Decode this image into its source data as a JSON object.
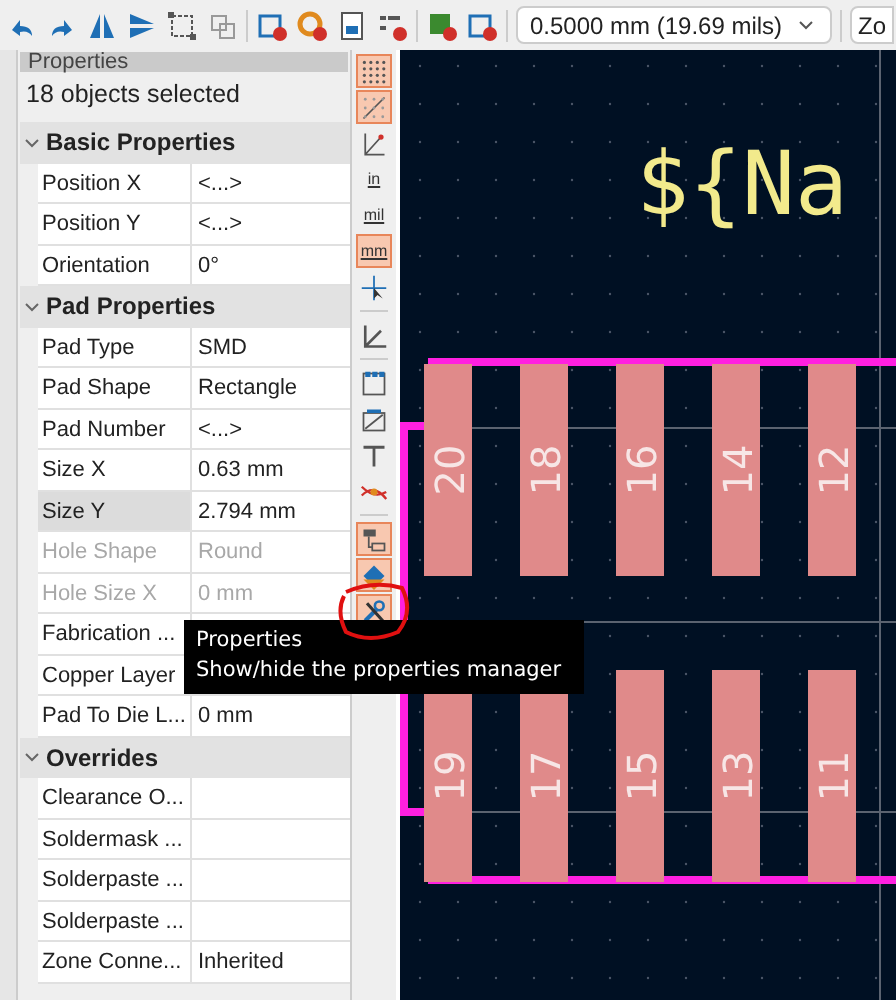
{
  "toolbar": {
    "icons": [
      {
        "kind": "undo"
      },
      {
        "kind": "redo"
      },
      {
        "kind": "flip-v"
      },
      {
        "kind": "flip-h"
      },
      {
        "kind": "group"
      },
      {
        "kind": "ungroup"
      },
      {
        "kind": "sep"
      },
      {
        "kind": "board-gear"
      },
      {
        "kind": "zone-gear"
      },
      {
        "kind": "report"
      },
      {
        "kind": "checklist"
      },
      {
        "kind": "sep"
      },
      {
        "kind": "board-down"
      },
      {
        "kind": "board-up"
      },
      {
        "kind": "sep"
      }
    ],
    "grid_dropdown": "0.5000 mm (19.69 mils)",
    "zoom_dropdown": "Zo"
  },
  "properties": {
    "title": "Properties",
    "summary": "18 objects selected",
    "rows": [
      {
        "kind": "section",
        "label": "Basic Properties"
      },
      {
        "kind": "prop",
        "label": "Position X",
        "value": "<...>",
        "disabled": false,
        "selected": false
      },
      {
        "kind": "prop",
        "label": "Position Y",
        "value": "<...>",
        "disabled": false,
        "selected": false
      },
      {
        "kind": "prop",
        "label": "Orientation",
        "value": "0°",
        "disabled": false,
        "selected": false
      },
      {
        "kind": "section",
        "label": "Pad Properties"
      },
      {
        "kind": "prop",
        "label": "Pad Type",
        "value": "SMD",
        "disabled": false,
        "selected": false
      },
      {
        "kind": "prop",
        "label": "Pad Shape",
        "value": "Rectangle",
        "disabled": false,
        "selected": false
      },
      {
        "kind": "prop",
        "label": "Pad Number",
        "value": "<...>",
        "disabled": false,
        "selected": false
      },
      {
        "kind": "prop",
        "label": "Size X",
        "value": "0.63 mm",
        "disabled": false,
        "selected": false
      },
      {
        "kind": "prop",
        "label": "Size Y",
        "value": "2.794 mm",
        "disabled": false,
        "selected": true
      },
      {
        "kind": "prop",
        "label": "Hole Shape",
        "value": "Round",
        "disabled": true,
        "selected": false
      },
      {
        "kind": "prop",
        "label": "Hole Size X",
        "value": "0 mm",
        "disabled": true,
        "selected": false
      },
      {
        "kind": "prop",
        "label": "Fabrication ...",
        "disabled": false,
        "selected": false
      },
      {
        "kind": "prop",
        "label": "Copper Layer",
        "disabled": false,
        "selected": false
      },
      {
        "kind": "prop",
        "label": "Pad To Die L...",
        "value": "0 mm",
        "disabled": false,
        "selected": false
      },
      {
        "kind": "section",
        "label": "Overrides"
      },
      {
        "kind": "prop",
        "label": "Clearance O...",
        "disabled": false,
        "selected": false
      },
      {
        "kind": "prop",
        "label": "Soldermask ...",
        "disabled": false,
        "selected": false
      },
      {
        "kind": "prop",
        "label": "Solderpaste ...",
        "disabled": false,
        "selected": false
      },
      {
        "kind": "prop",
        "label": "Solderpaste ...",
        "disabled": false,
        "selected": false
      },
      {
        "kind": "prop",
        "label": "Zone Conne...",
        "value": "Inherited",
        "disabled": false,
        "selected": false
      }
    ]
  },
  "side_toolbar": [
    {
      "kind": "grid",
      "on": true
    },
    {
      "kind": "grid-overlay",
      "on": true
    },
    {
      "kind": "polar",
      "on": false
    },
    {
      "kind": "unit",
      "label": "in",
      "on": false
    },
    {
      "kind": "unit",
      "label": "mil",
      "on": false
    },
    {
      "kind": "unit",
      "label": "mm",
      "on": true
    },
    {
      "kind": "cursor",
      "on": false
    },
    {
      "kind": "sep"
    },
    {
      "kind": "angle",
      "on": false
    },
    {
      "kind": "sep"
    },
    {
      "kind": "pads",
      "on": false
    },
    {
      "kind": "fab",
      "on": false
    },
    {
      "kind": "track",
      "on": false
    },
    {
      "kind": "ratsnest",
      "on": false
    },
    {
      "kind": "sep"
    },
    {
      "kind": "hierarchy",
      "on": true
    },
    {
      "kind": "layers",
      "on": true
    },
    {
      "kind": "properties",
      "on": true
    }
  ],
  "canvas": {
    "field_text": "${Na",
    "pad_rows": [
      [
        "20",
        "18",
        "16",
        "14",
        "12"
      ],
      [
        "19",
        "17",
        "15",
        "13",
        "11"
      ]
    ]
  },
  "tooltip": {
    "title": "Properties",
    "description": "Show/hide the properties manager"
  }
}
